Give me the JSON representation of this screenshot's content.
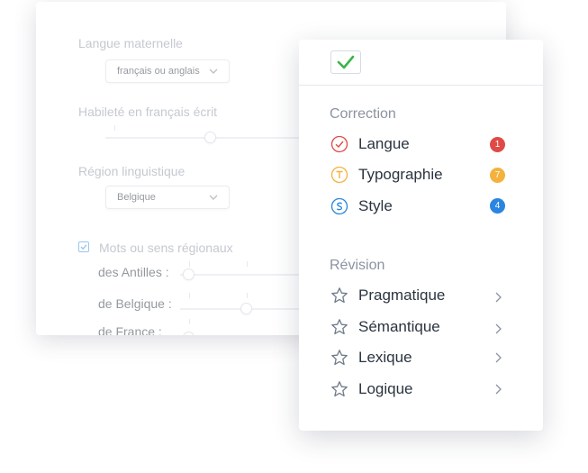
{
  "settings": {
    "mother_tongue": {
      "label": "Langue maternelle",
      "value": "français ou anglais"
    },
    "french_skill": {
      "label": "Habileté en français écrit"
    },
    "region": {
      "label": "Région linguistique",
      "value": "Belgique"
    },
    "regional_words": {
      "label": "Mots ou sens régionaux",
      "checked": true,
      "rows": [
        {
          "label": "des Antilles :"
        },
        {
          "label": "de Belgique :"
        },
        {
          "label": "de France :"
        }
      ]
    }
  },
  "popup": {
    "correction": {
      "title": "Correction",
      "items": [
        {
          "label": "Langue",
          "icon": "check-circle-icon",
          "count": "1",
          "color": "#e04a46"
        },
        {
          "label": "Typographie",
          "icon": "typography-icon",
          "count": "7",
          "color": "#f4b23d"
        },
        {
          "label": "Style",
          "icon": "style-icon",
          "count": "4",
          "color": "#2a85e0"
        }
      ]
    },
    "revision": {
      "title": "Révision",
      "items": [
        {
          "label": "Pragmatique"
        },
        {
          "label": "Sémantique"
        },
        {
          "label": "Lexique"
        },
        {
          "label": "Logique"
        }
      ]
    }
  }
}
